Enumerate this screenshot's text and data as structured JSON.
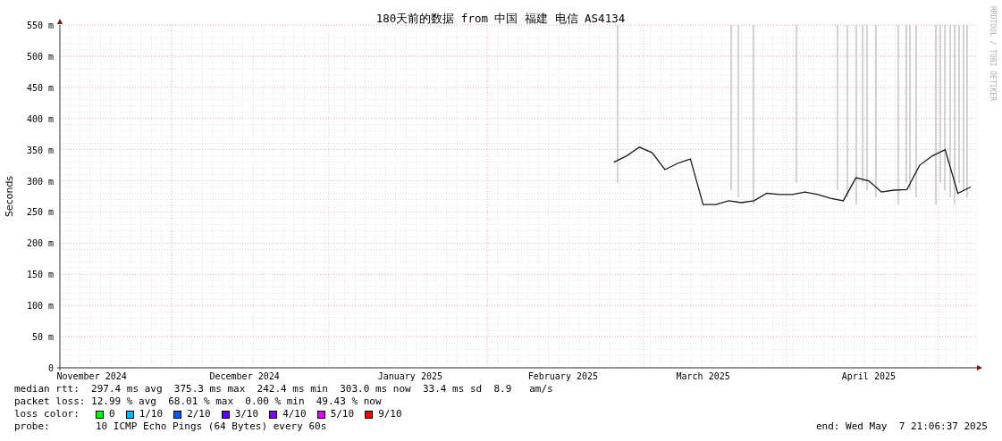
{
  "chart": {
    "chart_data": {
      "type": "line",
      "title": "180天前的数据 from 中国 福建 电信 AS4134",
      "ylabel": "Seconds",
      "grid": true,
      "ylim": [
        0,
        550
      ],
      "categories": [
        null,
        null,
        "November 2024",
        null,
        null,
        null,
        null,
        null,
        null,
        null,
        null,
        null,
        null,
        null,
        "December 2024",
        null,
        null,
        null,
        null,
        null,
        null,
        null,
        null,
        null,
        null,
        null,
        null,
        "January 2025",
        null,
        null,
        null,
        null,
        null,
        null,
        null,
        null,
        null,
        null,
        null,
        "February 2025",
        null,
        null,
        null,
        null,
        null,
        null,
        null,
        null,
        null,
        null,
        "March 2025",
        null,
        null,
        null,
        null,
        null,
        null,
        null,
        null,
        null,
        null,
        null,
        null,
        "April 2025",
        null,
        null,
        null,
        null,
        null,
        null,
        null,
        null
      ],
      "yticks": [
        {
          "value": 0,
          "label": "0"
        },
        {
          "value": 50,
          "label": "50 m"
        },
        {
          "value": 100,
          "label": "100 m"
        },
        {
          "value": 150,
          "label": "150 m"
        },
        {
          "value": 200,
          "label": "200 m"
        },
        {
          "value": 250,
          "label": "250 m"
        },
        {
          "value": 300,
          "label": "300 m"
        },
        {
          "value": 350,
          "label": "350 m"
        },
        {
          "value": 400,
          "label": "400 m"
        },
        {
          "value": 450,
          "label": "450 m"
        },
        {
          "value": 500,
          "label": "500 m"
        },
        {
          "value": 550,
          "label": "550 m"
        }
      ],
      "series": [
        {
          "color": "#1a1a1a",
          "values": [
            null,
            null,
            null,
            null,
            null,
            null,
            null,
            null,
            null,
            null,
            null,
            null,
            null,
            null,
            null,
            null,
            null,
            null,
            null,
            null,
            null,
            null,
            null,
            null,
            null,
            null,
            null,
            null,
            null,
            null,
            null,
            null,
            null,
            null,
            null,
            null,
            null,
            null,
            null,
            null,
            null,
            null,
            null,
            330,
            340,
            354,
            345,
            318,
            328,
            335,
            262,
            262,
            268,
            265,
            268,
            280,
            278,
            278,
            282,
            278,
            272,
            268,
            305,
            300,
            282,
            285,
            286,
            325,
            340,
            350,
            280,
            290
          ]
        }
      ]
    },
    "credit": "RRDTOOL / TOBI OETIKER"
  },
  "stats": [
    "median rtt:  297.4 ms avg  375.3 ms max  242.4 ms min  303.0 ms now  33.4 ms sd  8.9   am/s",
    "packet loss: 12.99 % avg  68.01 % max  0.00 % min  49.43 % now"
  ],
  "loss_color": {
    "label": "loss color:",
    "items": [
      {
        "label": "0",
        "color": "#00ff00"
      },
      {
        "label": "1/10",
        "color": "#00b8ff"
      },
      {
        "label": "2/10",
        "color": "#0059ff"
      },
      {
        "label": "3/10",
        "color": "#5e00ff"
      },
      {
        "label": "4/10",
        "color": "#7e00ff"
      },
      {
        "label": "5/10",
        "color": "#dd00ff"
      },
      {
        "label": "9/10",
        "color": "#ff0000"
      }
    ]
  },
  "probe": {
    "label": "probe:",
    "value": "10 ICMP Echo Pings (64 Bytes) every 60s"
  },
  "end": "end: Wed May  7 21:06:37 2025"
}
